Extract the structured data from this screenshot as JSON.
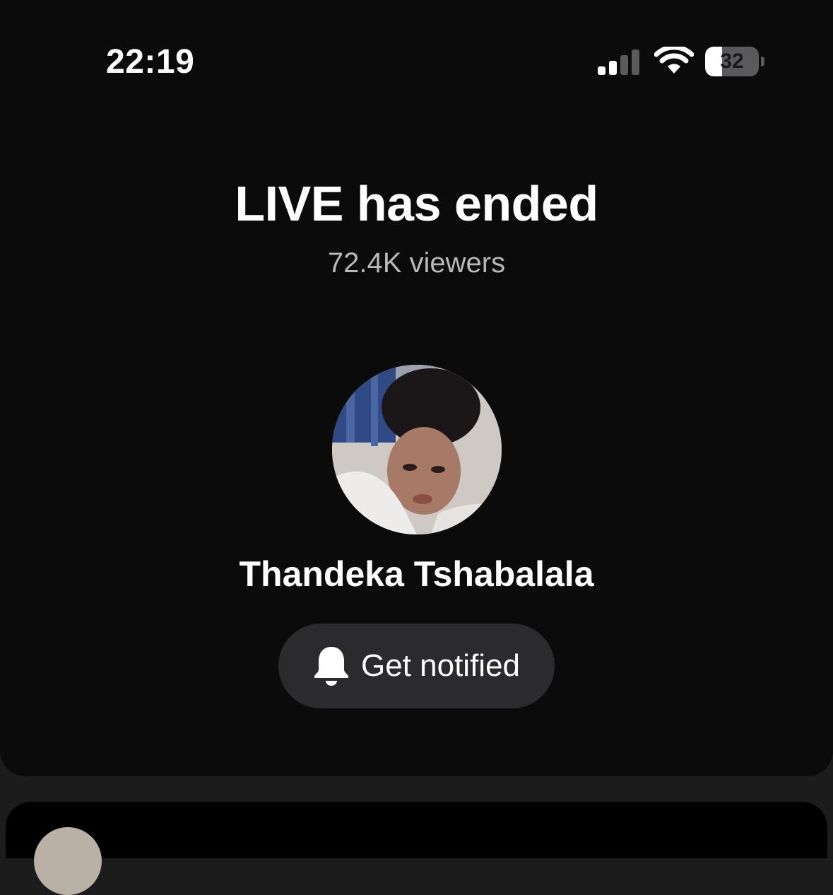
{
  "status_bar": {
    "time": "22:19",
    "battery_level": "32",
    "battery_fraction": 0.32,
    "signal_bars_active": 2,
    "signal_bars_total": 4
  },
  "live": {
    "title": "LIVE has ended",
    "viewers": "72.4K viewers"
  },
  "host": {
    "name": "Thandeka Tshabalala"
  },
  "notify_button": {
    "label": "Get notified",
    "icon": "bell-icon"
  },
  "colors": {
    "background": "#0b0b0c",
    "button_bg": "#2b2b2d",
    "secondary_text": "#b8b8b8"
  }
}
